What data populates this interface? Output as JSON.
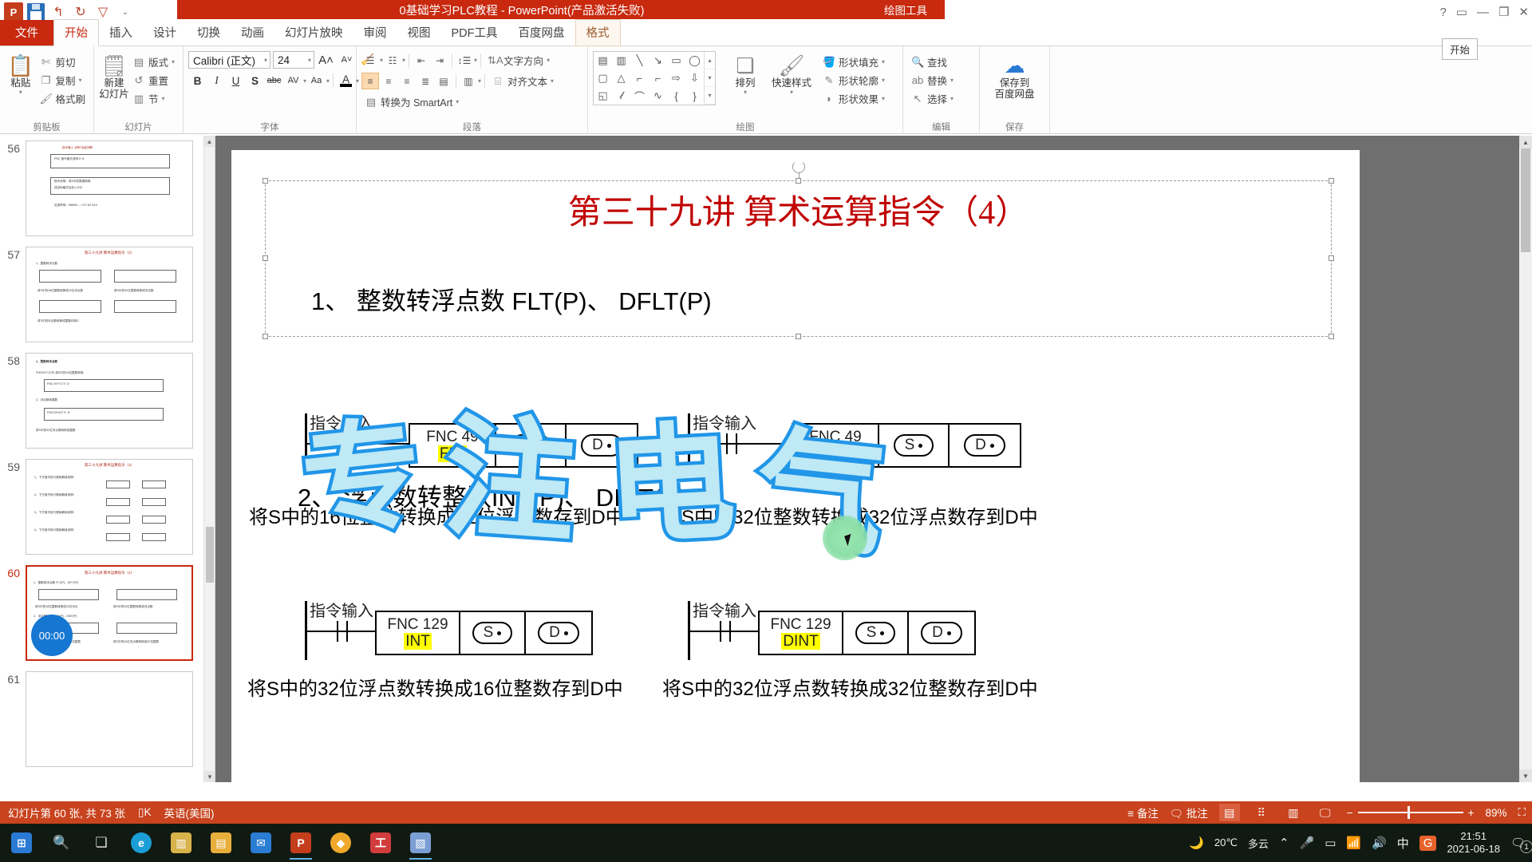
{
  "window": {
    "title": "0基础学习PLC教程 - PowerPoint(产品激活失败)",
    "context_tools": "绘图工具",
    "quick_access": [
      "ppt-logo",
      "save-icon",
      "undo-icon",
      "redo-icon",
      "start-presentation-icon",
      "more-icon"
    ],
    "help_label": "?",
    "restore_label": "⬜",
    "tooltip": "开始",
    "account_label": "P..."
  },
  "tabs": [
    {
      "label": "文件",
      "type": "file"
    },
    {
      "label": "开始",
      "type": "active"
    },
    {
      "label": "插入",
      "type": "normal"
    },
    {
      "label": "设计",
      "type": "normal"
    },
    {
      "label": "切换",
      "type": "normal"
    },
    {
      "label": "动画",
      "type": "normal"
    },
    {
      "label": "幻灯片放映",
      "type": "normal"
    },
    {
      "label": "审阅",
      "type": "normal"
    },
    {
      "label": "视图",
      "type": "normal"
    },
    {
      "label": "PDF工具",
      "type": "normal"
    },
    {
      "label": "百度网盘",
      "type": "normal"
    },
    {
      "label": "格式",
      "type": "ctx"
    }
  ],
  "ribbon": {
    "groups": [
      {
        "name": "剪贴板",
        "big": {
          "label": "粘贴",
          "icon": "clipboard-icon"
        },
        "items": [
          {
            "label": "剪切",
            "icon": "scissors-icon"
          },
          {
            "label": "复制",
            "icon": "copy-icon"
          },
          {
            "label": "格式刷",
            "icon": "format-painter-icon"
          }
        ]
      },
      {
        "name": "幻灯片",
        "big": {
          "label": "新建\n幻灯片",
          "label1": "新建",
          "label2": "幻灯片",
          "icon": "new-slide-icon"
        },
        "items": [
          {
            "label": "版式",
            "icon": "layout-icon"
          },
          {
            "label": "重置",
            "icon": "reset-icon"
          },
          {
            "label": "节",
            "icon": "section-icon"
          }
        ]
      },
      {
        "name": "字体",
        "font_name": "Calibri (正文)",
        "font_size": "24",
        "buttons": [
          "B",
          "I",
          "U",
          "S",
          "abc",
          "AV",
          "Aa",
          "A"
        ],
        "grow_label": "A",
        "shrink_label": "A",
        "clear_label": "清除格式"
      },
      {
        "name": "段落",
        "text_direction": "文字方向",
        "align_text": "对齐文本",
        "smartart": "转换为 SmartArt"
      },
      {
        "name": "绘图",
        "arrange_label": "排列",
        "quickstyle_label": "快速样式",
        "shape_fill": "形状填充",
        "shape_outline": "形状轮廓",
        "shape_effect": "形状效果"
      },
      {
        "name": "编辑",
        "find": "查找",
        "replace": "替换",
        "select": "选择"
      },
      {
        "name": "保存",
        "baidu_line1": "保存到",
        "baidu_line2": "百度网盘"
      }
    ]
  },
  "thumbnails": [
    {
      "number": "56",
      "selected": false
    },
    {
      "number": "57",
      "selected": false
    },
    {
      "number": "58",
      "selected": false
    },
    {
      "number": "59",
      "selected": false
    },
    {
      "number": "60",
      "selected": true
    },
    {
      "number": "61",
      "selected": false
    }
  ],
  "slide": {
    "title": "第三十九讲 算术运算指令（4）",
    "section1": "1、 整数转浮点数 FLT(P)、 DFLT(P)",
    "section2": "2、 浮点数转整数INT(P)、 DINT(P)",
    "ladders": [
      {
        "input_label": "指令输入",
        "fnc": "FNC  49",
        "mnemonic": "FLT",
        "operands": [
          "S",
          "D"
        ]
      },
      {
        "input_label": "指令输入",
        "fnc": "FNC 49",
        "mnemonic": "DFLT",
        "operands": [
          "S",
          "D"
        ]
      },
      {
        "input_label": "指令输入",
        "fnc": "FNC 129",
        "mnemonic": "INT",
        "operands": [
          "S",
          "D"
        ]
      },
      {
        "input_label": "指令输入",
        "fnc": "FNC 129",
        "mnemonic": "DINT",
        "operands": [
          "S",
          "D"
        ]
      }
    ],
    "descriptions": [
      "将S中的16位整数转换成32位浮点数存到D中",
      "将S中的32位整数转换成32位浮点数存到D中",
      "将S中的32位浮点数转换成16位整数存到D中",
      "将S中的32位浮点数转换成32位整数存到D中"
    ],
    "watermark": [
      "专",
      "注",
      "电",
      "气"
    ],
    "title_color": "#c00000",
    "highlight_color": "#ffff00"
  },
  "recorder": {
    "time": "00:00"
  },
  "status": {
    "slide_info": "幻灯片第 60 张, 共 73 张",
    "language": "英语(美国)",
    "notes": "备注",
    "comments": "批注",
    "zoom_level": "89%",
    "views": [
      "normal-view-icon",
      "slide-sorter-icon",
      "reading-view-icon",
      "slideshow-icon"
    ],
    "zoom_out": "−",
    "zoom_in": "+",
    "fit_icon": "fit-slide-icon"
  },
  "taskbar": {
    "start_icon": "windows-start-icon",
    "search_icon": "search-icon",
    "taskview_icon": "task-view-icon",
    "apps": [
      {
        "name": "edge-icon",
        "label": "e",
        "color": "#1b9ed8",
        "active": false
      },
      {
        "name": "store-icon",
        "label": "▥",
        "color": "#d8b24a",
        "active": false
      },
      {
        "name": "explorer-icon",
        "label": "▤",
        "color": "#e8ae3c",
        "active": false
      },
      {
        "name": "mail-icon",
        "label": "✉",
        "color": "#2b7cd3",
        "active": false
      },
      {
        "name": "powerpoint-icon",
        "label": "P",
        "color": "#c43e1c",
        "active": true
      },
      {
        "name": "vpn-icon",
        "label": "◆",
        "color": "#f0a92a",
        "active": false
      },
      {
        "name": "plc-icon",
        "label": "工",
        "color": "#d13c3c",
        "active": false
      },
      {
        "name": "capture-icon",
        "label": "⬒",
        "color": "#7b9fd4",
        "active": true
      }
    ],
    "weather": {
      "icon": "moon-cloud-icon",
      "temp": "20℃",
      "desc": "多云"
    },
    "tray": [
      "chevron-up-icon",
      "microphone-icon",
      "battery-icon",
      "wifi-icon",
      "volume-icon",
      "ime-icon",
      "google-icon"
    ],
    "ime_label": "中",
    "google_label": "G",
    "time": "21:51",
    "date": "2021-06-18",
    "notification_count": "1"
  }
}
